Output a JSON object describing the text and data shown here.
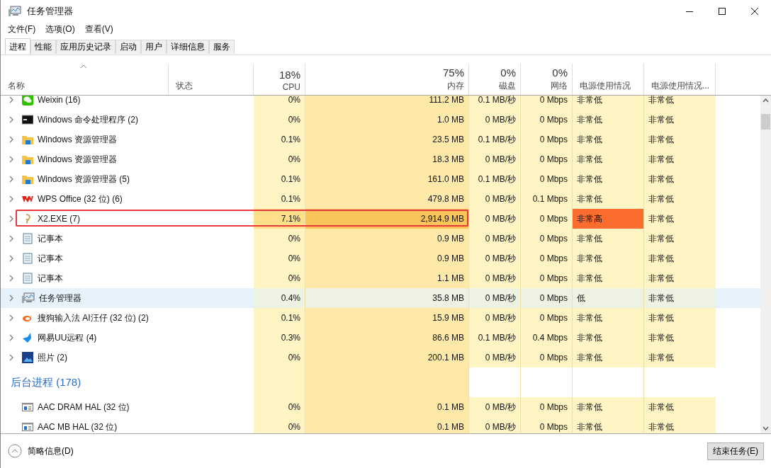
{
  "window": {
    "title": "任务管理器"
  },
  "menu": [
    "文件(F)",
    "选项(O)",
    "查看(V)"
  ],
  "tabs": [
    {
      "label": "进程",
      "selected": true
    },
    {
      "label": "性能",
      "selected": false
    },
    {
      "label": "应用历史记录",
      "selected": false
    },
    {
      "label": "启动",
      "selected": false
    },
    {
      "label": "用户",
      "selected": false
    },
    {
      "label": "详细信息",
      "selected": false
    },
    {
      "label": "服务",
      "selected": false
    }
  ],
  "columns": [
    {
      "label": "名称"
    },
    {
      "label": "状态"
    },
    {
      "total": "18%",
      "label": "CPU"
    },
    {
      "total": "75%",
      "label": "内存"
    },
    {
      "total": "0%",
      "label": "磁盘"
    },
    {
      "total": "0%",
      "label": "网络"
    },
    {
      "label": "电源使用情况"
    },
    {
      "label": "电源使用情况..."
    }
  ],
  "rows": [
    {
      "kind": "chat",
      "expandable": true,
      "name": "Weixin (16)",
      "cells": [
        "0%",
        "111.2 MB",
        "0.1 MB/秒",
        "0 Mbps",
        "非常低",
        "非常低"
      ],
      "high_usage": false,
      "hovered": false,
      "outlined": false
    },
    {
      "kind": "console",
      "expandable": true,
      "name": "Windows 命令处理程序 (2)",
      "cells": [
        "0%",
        "1.0 MB",
        "0 MB/秒",
        "0 Mbps",
        "非常低",
        "非常低"
      ],
      "high_usage": false,
      "hovered": false,
      "outlined": false
    },
    {
      "kind": "folder",
      "expandable": true,
      "name": "Windows 资源管理器",
      "cells": [
        "0.1%",
        "23.5 MB",
        "0.1 MB/秒",
        "0 Mbps",
        "非常低",
        "非常低"
      ],
      "high_usage": false,
      "hovered": false,
      "outlined": false
    },
    {
      "kind": "folder",
      "expandable": true,
      "name": "Windows 资源管理器",
      "cells": [
        "0%",
        "18.3 MB",
        "0 MB/秒",
        "0 Mbps",
        "非常低",
        "非常低"
      ],
      "high_usage": false,
      "hovered": false,
      "outlined": false
    },
    {
      "kind": "folder",
      "expandable": true,
      "name": "Windows 资源管理器 (5)",
      "cells": [
        "0.1%",
        "161.0 MB",
        "0.1 MB/秒",
        "0 Mbps",
        "非常低",
        "非常低"
      ],
      "high_usage": false,
      "hovered": false,
      "outlined": false
    },
    {
      "kind": "office",
      "expandable": true,
      "name": "WPS Office (32 位) (6)",
      "cells": [
        "0.1%",
        "479.8 MB",
        "0 MB/秒",
        "0.1 Mbps",
        "非常低",
        "非常低"
      ],
      "high_usage": false,
      "hovered": false,
      "outlined": false
    },
    {
      "kind": "swirl",
      "expandable": true,
      "name": "X2.EXE (7)",
      "cells": [
        "7.1%",
        "2,914.9 MB",
        "0 MB/秒",
        "0 Mbps",
        "非常高",
        "非常低"
      ],
      "high_usage": true,
      "hovered": false,
      "outlined": true
    },
    {
      "kind": "notepad",
      "expandable": true,
      "name": "记事本",
      "cells": [
        "0%",
        "0.9 MB",
        "0 MB/秒",
        "0 Mbps",
        "非常低",
        "非常低"
      ],
      "high_usage": false,
      "hovered": false,
      "outlined": false
    },
    {
      "kind": "notepad",
      "expandable": true,
      "name": "记事本",
      "cells": [
        "0%",
        "0.9 MB",
        "0 MB/秒",
        "0 Mbps",
        "非常低",
        "非常低"
      ],
      "high_usage": false,
      "hovered": false,
      "outlined": false
    },
    {
      "kind": "notepad",
      "expandable": true,
      "name": "记事本",
      "cells": [
        "0%",
        "1.1 MB",
        "0 MB/秒",
        "0 Mbps",
        "非常低",
        "非常低"
      ],
      "high_usage": false,
      "hovered": false,
      "outlined": false
    },
    {
      "kind": "monitor",
      "expandable": true,
      "name": "任务管理器",
      "cells": [
        "0.4%",
        "35.8 MB",
        "0 MB/秒",
        "0 Mbps",
        "低",
        "非常低"
      ],
      "high_usage": false,
      "hovered": true,
      "outlined": false
    },
    {
      "kind": "dog",
      "expandable": true,
      "name": "搜狗输入法 AI汪仔 (32 位) (2)",
      "cells": [
        "0.1%",
        "15.9 MB",
        "0 MB/秒",
        "0 Mbps",
        "非常低",
        "非常低"
      ],
      "high_usage": false,
      "hovered": false,
      "outlined": false
    },
    {
      "kind": "bird",
      "expandable": true,
      "name": "网易UU远程 (4)",
      "cells": [
        "0.3%",
        "86.6 MB",
        "0.1 MB/秒",
        "0.4 Mbps",
        "非常低",
        "非常低"
      ],
      "high_usage": false,
      "hovered": false,
      "outlined": false
    },
    {
      "kind": "photo",
      "expandable": true,
      "name": "照片 (2)",
      "cells": [
        "0%",
        "200.1 MB",
        "0 MB/秒",
        "0 Mbps",
        "非常低",
        "非常低"
      ],
      "high_usage": false,
      "hovered": false,
      "outlined": false
    },
    {
      "kind": "group",
      "name": "后台进程 (178)"
    },
    {
      "kind": "service",
      "expandable": false,
      "name": "AAC DRAM HAL (32 位)",
      "cells": [
        "0%",
        "0.1 MB",
        "0 MB/秒",
        "0 Mbps",
        "非常低",
        "非常低"
      ],
      "high_usage": false,
      "hovered": false,
      "outlined": false
    },
    {
      "kind": "service",
      "expandable": false,
      "name": "AAC MB HAL (32 位)",
      "cells": [
        "0%",
        "0.1 MB",
        "0 MB/秒",
        "0 Mbps",
        "非常低",
        "非常低"
      ],
      "high_usage": false,
      "hovered": false,
      "outlined": false
    }
  ],
  "footer": {
    "details_toggle": "简略信息(D)",
    "end_task": "结束任务(E)"
  }
}
